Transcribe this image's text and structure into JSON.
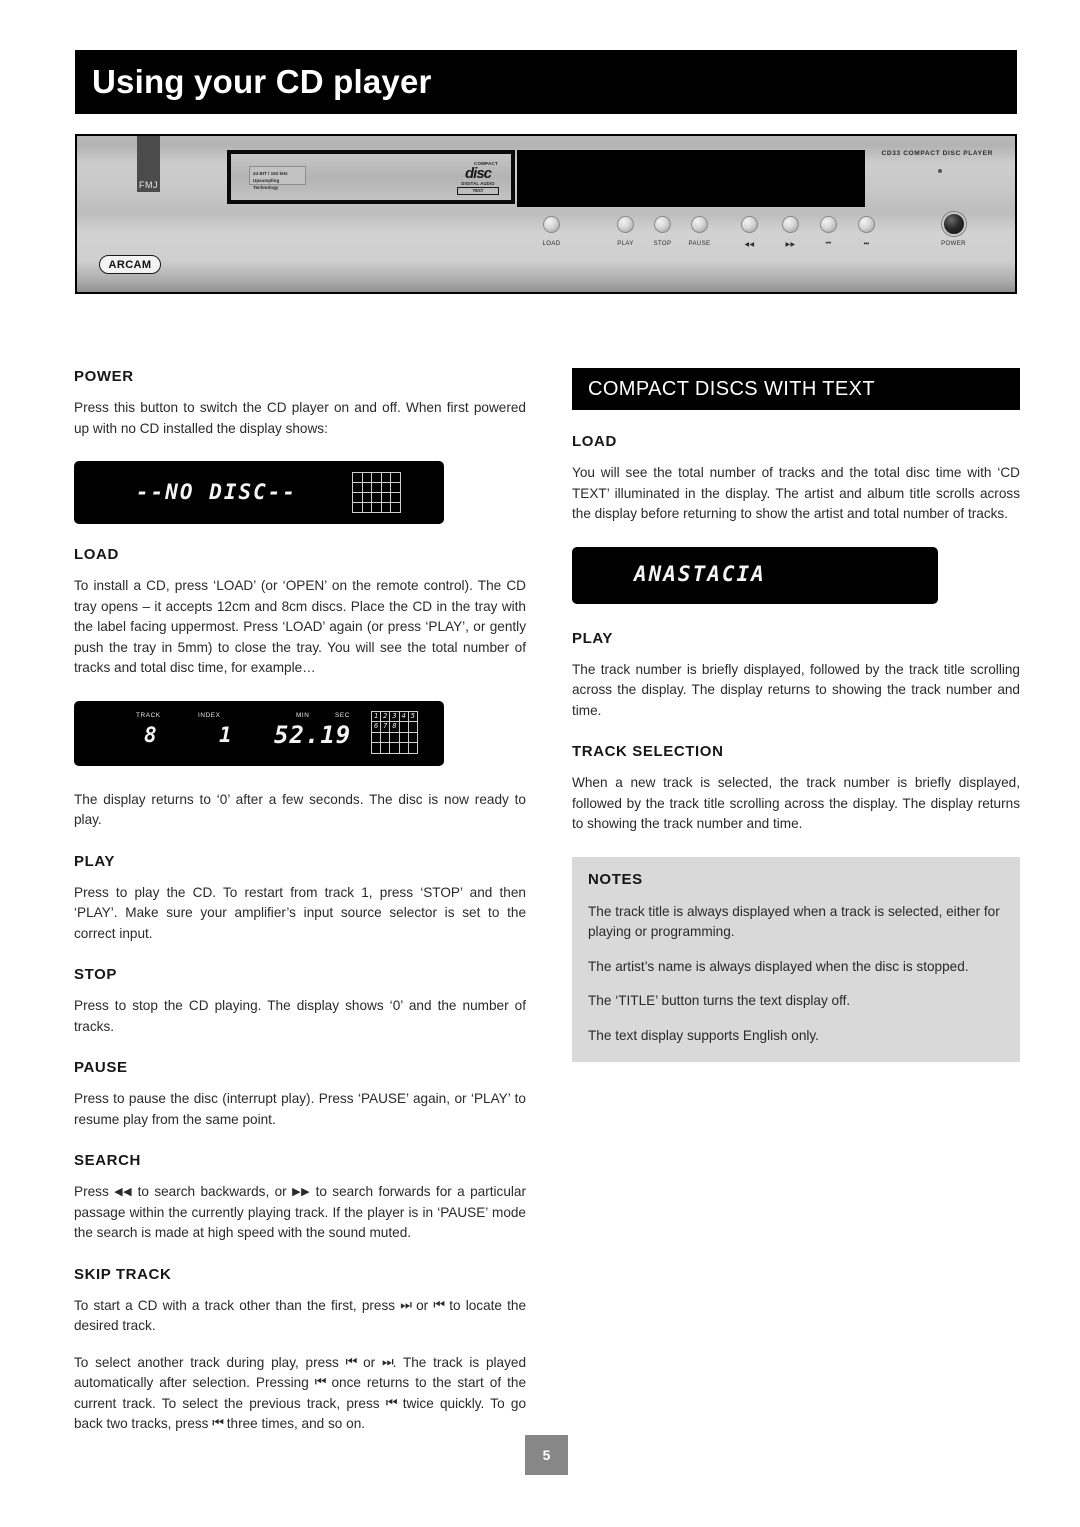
{
  "page": {
    "title": "Using your CD player",
    "number": "5"
  },
  "device": {
    "brand": "ARCAM",
    "series_badge": "FMJ",
    "model_label": "CD33 COMPACT DISC PLAYER",
    "upsampling_badge": {
      "line1": "24 BIT / 192 kHz",
      "line2": "Upsampling Technology"
    },
    "cd_logo": {
      "compact": "COMPACT",
      "disc": "disc",
      "digital_audio": "DIGITAL AUDIO",
      "text": "TEXT"
    },
    "buttons": [
      {
        "label": "LOAD",
        "glyph": ""
      },
      {
        "label": "PLAY",
        "glyph": ""
      },
      {
        "label": "STOP",
        "glyph": ""
      },
      {
        "label": "PAUSE",
        "glyph": ""
      },
      {
        "label": "◀◀",
        "glyph": "search-back"
      },
      {
        "label": "▶▶",
        "glyph": "search-fwd"
      },
      {
        "label": "⏮",
        "glyph": "skip-back"
      },
      {
        "label": "⏭",
        "glyph": "skip-fwd"
      }
    ],
    "power_label": "POWER"
  },
  "left_column": {
    "power": {
      "heading": "POWER",
      "body": "Press this button to switch the CD player on and off. When first powered up with no CD installed the display shows:"
    },
    "lcd_no_disc": {
      "text": "--NO DISC--",
      "grid_cells": [
        "",
        "",
        "",
        "",
        "",
        "",
        "",
        "",
        "",
        "",
        "",
        "",
        "",
        "",
        "",
        "",
        "",
        "",
        "",
        ""
      ]
    },
    "load": {
      "heading": "LOAD",
      "body": "To install a CD, press ‘LOAD’ (or ‘OPEN’ on the remote control). The CD tray opens – it accepts 12cm and 8cm discs. Place the CD in the tray with the label facing uppermost. Press ‘LOAD’ again (or press ‘PLAY’, or gently push the tray in 5mm) to close the tray. You will see the total number of tracks and total disc time, for example…"
    },
    "lcd_track": {
      "label_track": "TRACK",
      "label_index": "INDEX",
      "label_min": "MIN",
      "label_sec": "SEC",
      "value_track": "8",
      "value_index": "1",
      "value_time": "52.19",
      "grid_cells": [
        "1",
        "2",
        "3",
        "4",
        "5",
        "6",
        "7",
        "8",
        "",
        "",
        "",
        "",
        "",
        "",
        "",
        "",
        "",
        "",
        "",
        ""
      ]
    },
    "after_load": {
      "body": "The display returns to ‘0’ after a few seconds. The disc is now ready to play."
    },
    "play": {
      "heading": "PLAY",
      "body": "Press to play the CD. To restart from track 1, press ‘STOP’ and then ‘PLAY’. Make sure your amplifier’s input source selector is set to the correct input."
    },
    "stop": {
      "heading": "STOP",
      "body": "Press to stop the CD playing. The display shows ‘0’ and the number of tracks."
    },
    "pause": {
      "heading": "PAUSE",
      "body": "Press to pause the disc (interrupt play). Press ‘PAUSE’ again, or ‘PLAY’ to resume play from the same point."
    },
    "search": {
      "heading": "SEARCH",
      "body_part1": "Press",
      "glyph_back": "◀◀",
      "body_part2": "to search backwards, or",
      "glyph_fwd": "▶▶",
      "body_part3": "to search forwards for a particular passage within the currently playing track. If the player is in ‘PAUSE’ mode the search is made at high speed with the sound muted."
    },
    "skip_track": {
      "heading": "SKIP TRACK",
      "para1_a": "To start a CD with a track other than the first, press",
      "para1_g1": "⏭",
      "para1_b": "or",
      "para1_g2": "⏮",
      "para1_c": "to locate the desired track.",
      "para2_a": "To select another track during play, press",
      "para2_g1": "⏮",
      "para2_b": "or",
      "para2_g2": "⏭",
      "para2_c": ". The track is played automatically after selection. Pressing",
      "para2_g3": "⏮",
      "para2_d": "once returns to the start of the current track. To select the previous track, press",
      "para2_g4": "⏮",
      "para2_e": "twice quickly. To go back two tracks, press",
      "para2_g5": "⏮",
      "para2_f": "three times, and so on."
    }
  },
  "right_column": {
    "section_header": "COMPACT DISCS WITH TEXT",
    "load": {
      "heading": "LOAD",
      "body": "You will see the total number of tracks and the total disc time with ‘CD TEXT’ illuminated in the display. The artist and album title scrolls across the display before returning to show the artist and total number of tracks."
    },
    "lcd_artist": {
      "text": "ANASTACIA"
    },
    "play": {
      "heading": "PLAY",
      "body": "The track number is briefly displayed, followed by the track title scrolling across the display. The display returns to showing the track number and time."
    },
    "track_selection": {
      "heading": "TRACK SELECTION",
      "body": "When a new track is selected, the track number is briefly displayed, followed by the track title scrolling across the display. The display returns to showing the track number and time."
    },
    "notes": {
      "heading": "NOTES",
      "items": [
        "The track title is always displayed when a track is selected, either for playing or programming.",
        "The artist’s name is always displayed when the disc is stopped.",
        "The ‘TITLE’ button turns the text display off.",
        "The text display supports English only."
      ]
    }
  },
  "colors": {
    "banner_bg": "#000000",
    "banner_fg": "#ffffff",
    "notes_bg": "#d9d9d9",
    "page_num_bg": "#878787",
    "lcd_bg": "#000000",
    "lcd_fg": "#f4f4f4"
  }
}
